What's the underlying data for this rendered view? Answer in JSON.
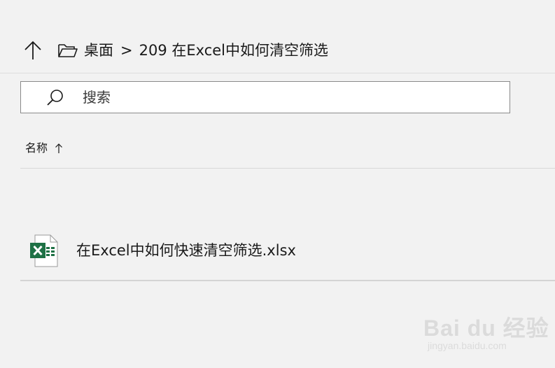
{
  "breadcrumb": {
    "items": [
      "桌面",
      "209 在Excel中如何清空筛选"
    ],
    "separator": ">"
  },
  "search": {
    "placeholder": "搜索",
    "value": ""
  },
  "list": {
    "column_header": "名称",
    "sort_direction": "ascending",
    "files": [
      {
        "name": "在Excel中如何快速清空筛选.xlsx",
        "icon": "excel-file-icon"
      }
    ]
  },
  "watermark": {
    "logo_text": "Bai du 经验",
    "url_text": "jingyan.baidu.com"
  },
  "colors": {
    "background": "#f2f2f2",
    "excel_green": "#1e7145",
    "border": "#8a8a8a"
  }
}
